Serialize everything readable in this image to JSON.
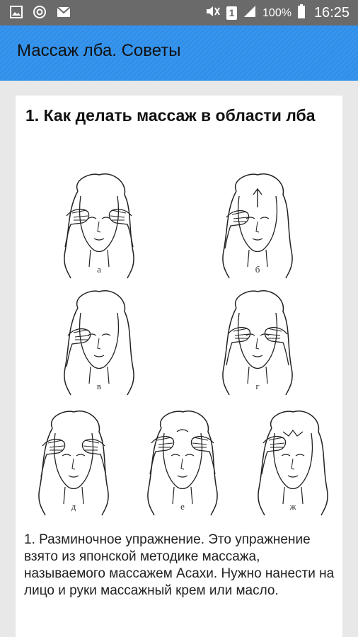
{
  "status_bar": {
    "battery_percent": "100%",
    "time": "16:25",
    "sim_badge": "1",
    "icons_left": [
      "image-icon",
      "sync-icon",
      "mail-icon"
    ],
    "icons_right": [
      "mute-icon",
      "sim-icon",
      "signal-icon",
      "battery-icon"
    ]
  },
  "toolbar": {
    "title": "Массаж лба. Советы",
    "color": "#2f8fea"
  },
  "article": {
    "heading": "1. Как делать массаж в области лба",
    "figure_captions": [
      "а",
      "б",
      "в",
      "г",
      "д",
      "е",
      "ж"
    ],
    "paragraph": "1. Разминочное упражнение. Это упражнение взято из японской методике массажа, называемого массажем Асахи. Нужно нанести на лицо и руки массажный крем или масло."
  }
}
